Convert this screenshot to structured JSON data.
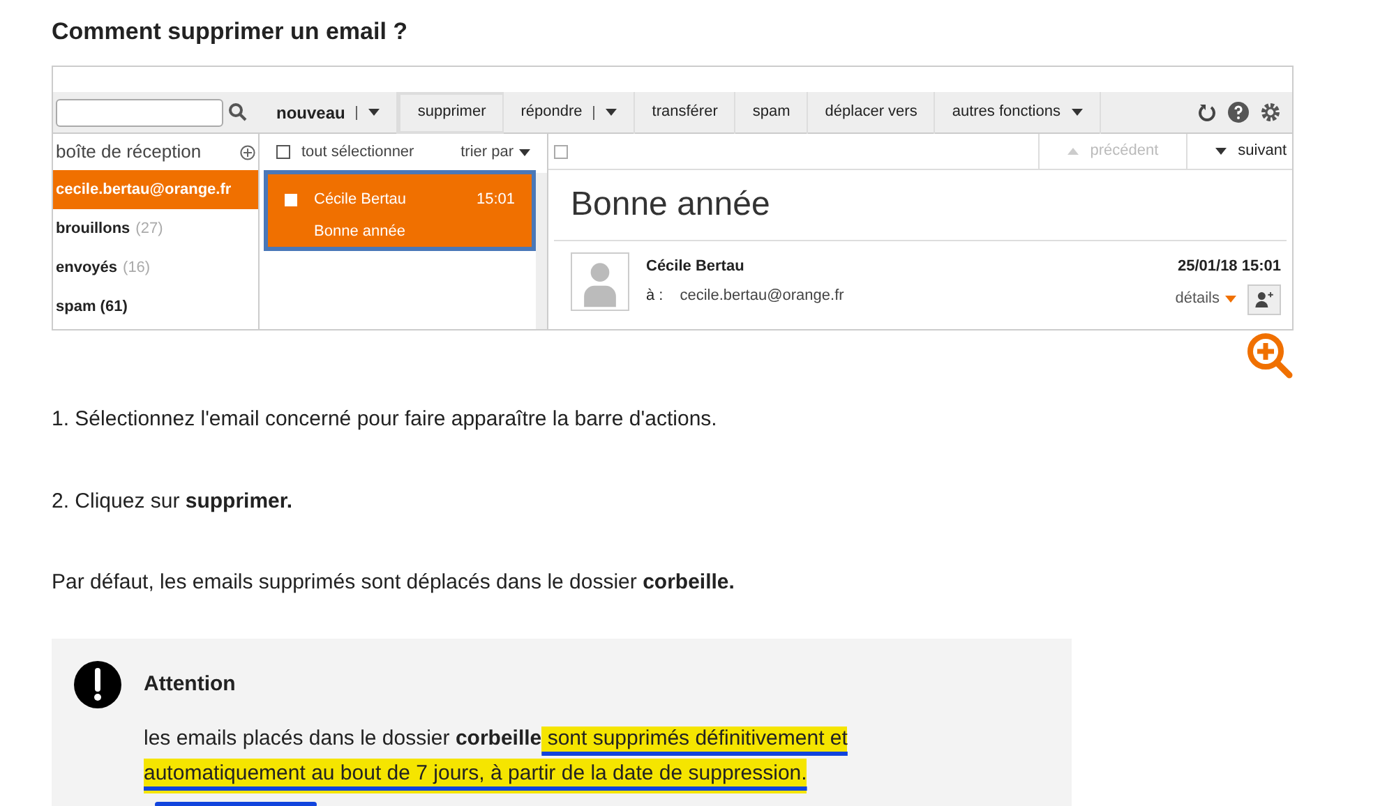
{
  "heading": "Comment supprimer un email ?",
  "mail": {
    "toolbar": [
      {
        "label": "nouveau",
        "kind": "split",
        "selected": false
      },
      {
        "label": "supprimer",
        "kind": "plain",
        "selected": true
      },
      {
        "label": "répondre",
        "kind": "split",
        "selected": false
      },
      {
        "label": "transférer",
        "kind": "plain",
        "selected": false
      },
      {
        "label": "spam",
        "kind": "plain",
        "selected": false
      },
      {
        "label": "déplacer vers",
        "kind": "plain",
        "selected": false
      },
      {
        "label": "autres fonctions",
        "kind": "menu",
        "selected": false
      }
    ],
    "inbox_title": "boîte de réception",
    "folders": [
      {
        "name": "cecile.bertau@orange.fr",
        "selected": true
      },
      {
        "name": "brouillons",
        "count": "(27)",
        "selected": false
      },
      {
        "name": "envoyés",
        "count": "(16)",
        "selected": false
      },
      {
        "name": "spam (61)",
        "selected": false
      }
    ],
    "select_all": "tout sélectionner",
    "select_all_checked": false,
    "sort": "trier par",
    "messages": [
      {
        "sender": "Cécile Bertau",
        "time": "15:01",
        "subject": "Bonne année",
        "selected": true,
        "checked": false
      }
    ],
    "previous": "précédent",
    "next": "suivant",
    "subject": "Bonne année",
    "from": "Cécile Bertau",
    "to_label": "à :",
    "to": "cecile.bertau@orange.fr",
    "date": "25/01/18 15:01",
    "details": "détails"
  },
  "steps": [
    "1. Sélectionnez l'email concerné pour faire apparaître la barre d'actions.",
    "2. Cliquez sur **supprimer.**",
    "Par défaut, les emails supprimés sont déplacés dans le dossier **corbeille.**"
  ],
  "notice": {
    "title": "Attention",
    "text": "les emails placés dans le dossier **corbeille**",
    "highlight": [
      " sont supprimés définitivement et",
      "automatiquement au bout de 7 jours, à partir de la date de suppression."
    ]
  }
}
